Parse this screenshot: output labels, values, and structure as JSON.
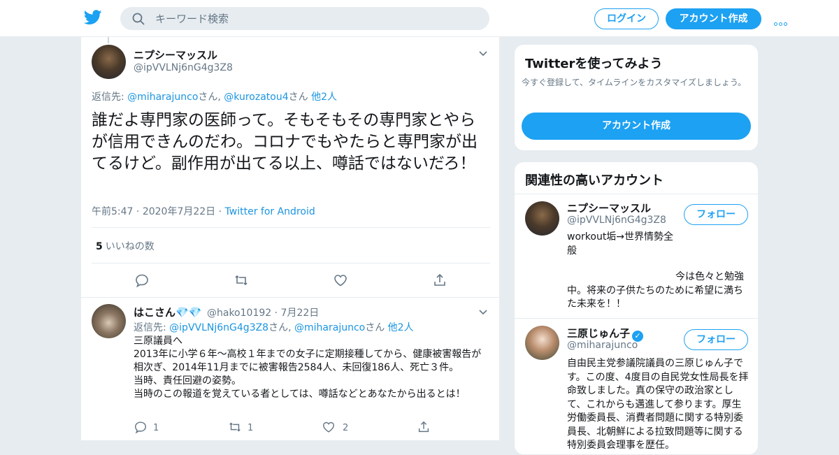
{
  "header": {
    "search_placeholder": "キーワード検索",
    "login_label": "ログイン",
    "signup_label": "アカウント作成",
    "brand_color": "#1da1f2"
  },
  "main_tweet": {
    "name": "ニプシーマッスル",
    "handle": "@ipVVLNj6nG4g3Z8",
    "reply_prefix": "返信先: ",
    "reply_user1": "@miharajunco",
    "reply_sep1": "さん, ",
    "reply_user2": "@kurozatou4",
    "reply_sep2": "さん ",
    "reply_others": "他2人",
    "text": "誰だよ専門家の医師って。そもそもその専門家とやらが信用できんのだわ。コロナでもやたらと専門家が出てるけど。副作用が出てる以上、噂話ではないだろ！",
    "time": "午前5:47",
    "date": "2020年7月22日",
    "source": "Twitter for Android",
    "like_count": "5",
    "like_label": "いいねの数"
  },
  "reply_tweet": {
    "name": "はこさん💎💎",
    "handle": "@hako10192",
    "date": "7月22日",
    "reply_prefix": "返信先: ",
    "reply_user1": "@ipVVLNj6nG4g3Z8",
    "reply_sep1": "さん, ",
    "reply_user2": "@miharajunco",
    "reply_sep2": "さん ",
    "reply_others": "他2人",
    "line1": "三原議員へ",
    "line2": "2013年に小学６年～高校１年までの女子に定期接種してから、健康被害報告が相次ぎ、2014年11月までに被害報告2584人、未回復186人、死亡３件。",
    "line3": "当時、責任回避の姿勢。",
    "line4": "当時のこの報道を覚えている者としては、噂話などとあなたから出るとは！",
    "reply_count": "1",
    "retweet_count": "1",
    "like_count": "2"
  },
  "sidebar": {
    "try_title": "Twitterを使ってみよう",
    "try_sub": "今すぐ登録して、タイムラインをカスタマイズしましょう。",
    "try_button": "アカウント作成",
    "related_title": "関連性の高いアカウント",
    "accounts": [
      {
        "name": "ニプシーマッスル",
        "handle": "@ipVVLNj6nG4g3Z8",
        "follow_label": "フォロー",
        "bio1": "workout垢→世界情勢全般",
        "bio2": "今は色々と勉強中。将来の子供たちのために希望に満ちた未来を！！"
      },
      {
        "name": "三原じゅん子",
        "verified_mark": "✓",
        "handle": "@miharajunco",
        "follow_label": "フォロー",
        "bio1": "自由民主党参議院議員の三原じゅん子です。この度、4度目の自民党女性局長を拝命致しました。真の保守の政治家として、これからも邁進して参ります。厚生労働委員長、消費者問題に関する特別委員長、北朝鮮による拉致問題等に関する特別委員会理事を歴任。"
      }
    ]
  }
}
